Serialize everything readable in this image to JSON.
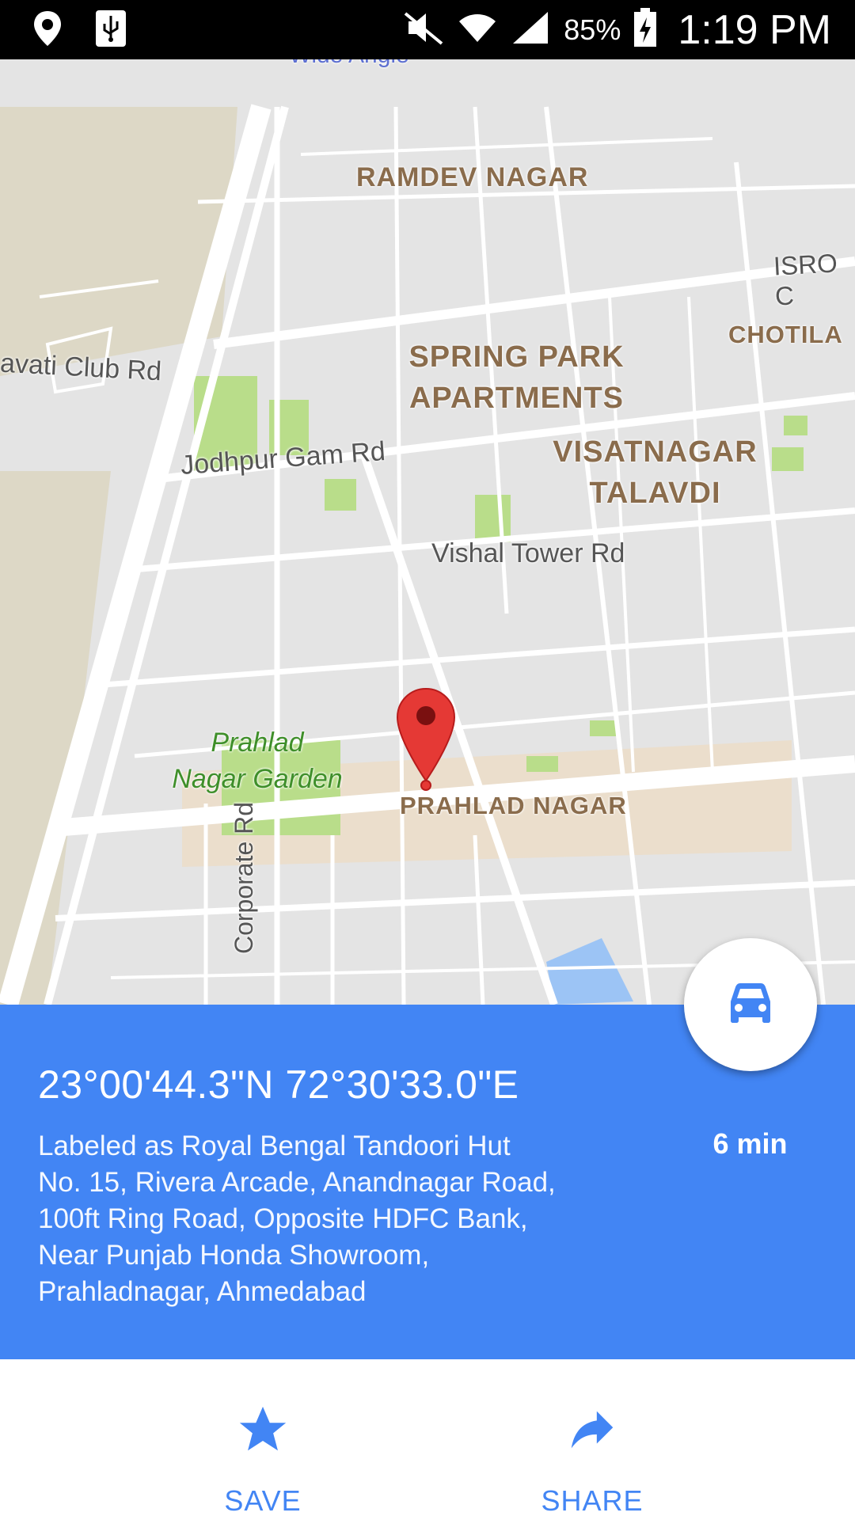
{
  "status_bar": {
    "battery_percent": "85%",
    "time": "1:19 PM",
    "icons": [
      "location-icon",
      "usb-icon",
      "mute-icon",
      "wifi-icon",
      "signal-icon",
      "battery-charging-icon"
    ]
  },
  "map": {
    "area_labels": {
      "ramdev_nagar": "RAMDEV NAGAR",
      "isro": "ISRO C",
      "chotila": "CHOTILA",
      "spring_park_line1": "SPRING PARK",
      "spring_park_line2": "APARTMENTS",
      "visatnagar_line1": "VISATNAGAR",
      "visatnagar_line2": "TALAVDI",
      "prahlad_nagar": "PRAHLAD NAGAR"
    },
    "street_labels": {
      "club_rd": "avati Club Rd",
      "jodhpur_gam_rd": "Jodhpur Gam Rd",
      "vishal_tower_rd": "Vishal Tower Rd",
      "corporate_rd": "Corporate Rd",
      "wide_angle": "Wide Angle"
    },
    "park_label": {
      "line1": "Prahlad",
      "line2": "Nagar Garden"
    }
  },
  "place": {
    "coordinates": "23°00'44.3\"N 72°30'33.0\"E",
    "address_lines": [
      "Labeled as Royal Bengal Tandoori Hut",
      "No. 15, Rivera Arcade, Anandnagar Road,",
      "100ft Ring Road, Opposite HDFC Bank,",
      "Near Punjab Honda Showroom,",
      "Prahladnagar, Ahmedabad"
    ],
    "drive_eta": "6 min"
  },
  "actions": {
    "save_label": "SAVE",
    "share_label": "SHARE"
  },
  "colors": {
    "accent": "#4285f4",
    "pin": "#e53935",
    "map_bg": "#e4e4e4"
  }
}
